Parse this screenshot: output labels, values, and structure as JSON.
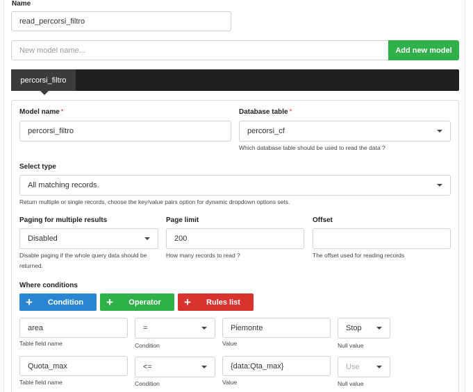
{
  "top": {
    "name_label": "Name",
    "name_value": "read_percorsi_filtro",
    "new_model_placeholder": "New model name...",
    "add_model_button": "Add new model"
  },
  "tabs": [
    {
      "label": "percorsi_filtro",
      "active": true
    }
  ],
  "model": {
    "model_name_label": "Model name",
    "model_name_value": "percorsi_filtro",
    "db_table_label": "Database table",
    "db_table_value": "percorsi_cf",
    "db_table_help": "Which database table should be used to read the data ?",
    "select_type_label": "Select type",
    "select_type_value": "All matching records.",
    "select_type_help": "Return multiple or single records, choose the key/value pairs option for dynamic dropdown options sets.",
    "paging_label": "Paging for multiple results",
    "paging_value": "Disabled",
    "paging_help": "Disable paging if the whole query data should be returned.",
    "page_limit_label": "Page limit",
    "page_limit_value": "200",
    "page_limit_help": "How many records to read ?",
    "offset_label": "Offset",
    "offset_value": "",
    "offset_help": "The offset used for reading records"
  },
  "where": {
    "label": "Where conditions",
    "buttons": {
      "plus": "+",
      "condition": "Condition",
      "operator": "Operator",
      "rules_list": "Rules list"
    },
    "sublabels": {
      "field": "Table field name",
      "condition": "Condition",
      "value": "Value",
      "null": "Null value"
    },
    "rows": [
      {
        "field": "area",
        "condition": "=",
        "value": "Piemonte",
        "null_value": "Stop",
        "null_disabled": false
      },
      {
        "field": "Quota_max",
        "condition": "<=",
        "value": "{data:Qta_max}",
        "null_value": "Use",
        "null_disabled": true
      }
    ]
  },
  "colors": {
    "tab_bar": "#1e1f21",
    "tab_active": "#3a3b3d",
    "green": "#2fb049",
    "blue": "#2a86d3",
    "red": "#d9322f"
  }
}
